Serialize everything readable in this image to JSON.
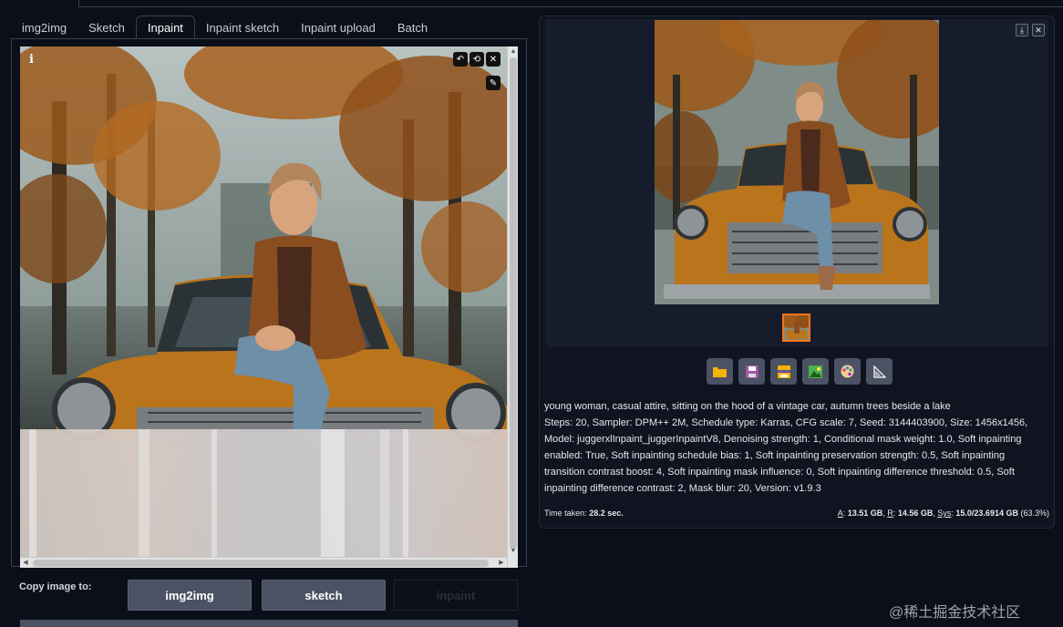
{
  "tabs": [
    {
      "label": "img2img",
      "active": false
    },
    {
      "label": "Sketch",
      "active": false
    },
    {
      "label": "Inpaint",
      "active": true
    },
    {
      "label": "Inpaint sketch",
      "active": false
    },
    {
      "label": "Inpaint upload",
      "active": false
    },
    {
      "label": "Batch",
      "active": false
    }
  ],
  "editor": {
    "info_glyph": "i",
    "tools": [
      "undo-icon",
      "reset-icon",
      "close-icon",
      "brush-icon"
    ]
  },
  "copy": {
    "label": "Copy image to:",
    "buttons": [
      "img2img",
      "sketch",
      "inpaint"
    ]
  },
  "gallery": {
    "controls": [
      "download-icon",
      "close-icon"
    ],
    "actions": [
      "folder-icon",
      "save-icon",
      "zip-icon",
      "send-to-img2img-icon",
      "send-to-inpaint-icon",
      "send-to-extras-icon"
    ]
  },
  "generation_info": {
    "prompt": "young woman, casual attire, sitting on the hood of a vintage car, autumn trees beside a lake",
    "params": "Steps: 20, Sampler: DPM++ 2M, Schedule type: Karras, CFG scale: 7, Seed: 3144403900, Size: 1456x1456, Model: juggerxlInpaint_juggerInpaintV8, Denoising strength: 1, Conditional mask weight: 1.0, Soft inpainting enabled: True, Soft inpainting schedule bias: 1, Soft inpainting preservation strength: 0.5, Soft inpainting transition contrast boost: 4, Soft inpainting mask influence: 0, Soft inpainting difference threshold: 0.5, Soft inpainting difference contrast: 2, Mask blur: 20, Version: v1.9.3"
  },
  "stats": {
    "time_label": "Time taken:",
    "time_value": "28.2 sec.",
    "a_label": "A",
    "a_value": "13.51 GB",
    "r_label": "R",
    "r_value": "14.56 GB",
    "sys_label": "Sys",
    "sys_value": "15.0/23.6914 GB",
    "sys_pct": "(63.3%)"
  },
  "watermark": "@稀土掘金技术社区",
  "colors": {
    "accent": "#f97316",
    "button": "#4b5263",
    "background": "#0b0f19"
  }
}
